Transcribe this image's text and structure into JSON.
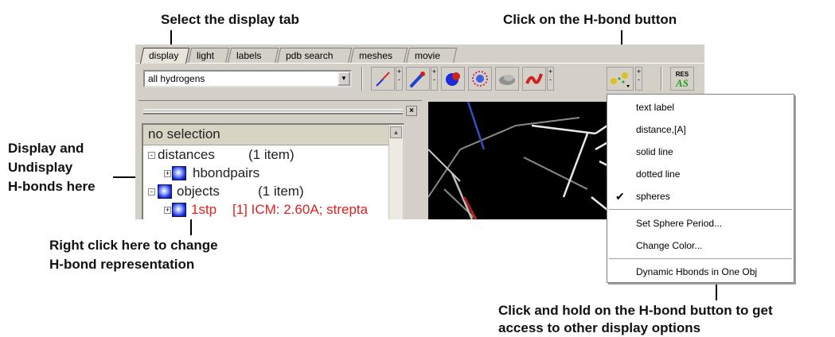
{
  "annotations": {
    "select_tab": "Select the display tab",
    "click_hbond": "Click on the H-bond button",
    "display_undisplay_1": "Display and",
    "display_undisplay_2": "Undisplay",
    "display_undisplay_3": "H-bonds here",
    "right_click_1": "Right click here to change",
    "right_click_2": "H-bond representation",
    "click_hold_1": "Click and hold on the H-bond button to get",
    "click_hold_2": "access to other display options"
  },
  "tabs": [
    "display",
    "light",
    "labels",
    "pdb search",
    "meshes",
    "movie"
  ],
  "toolbar": {
    "combo_value": "all hydrogens",
    "res_label": "RES",
    "as_label": "AS",
    "icons": [
      "wire-icon",
      "stick-icon",
      "ball-icon",
      "surface-icon",
      "skin-icon",
      "ribbon-icon",
      "hbond-icon"
    ]
  },
  "tree": {
    "selection": "no selection",
    "rows": [
      {
        "label": "distances",
        "count": "(1 item)"
      },
      {
        "label": "hbondpairs"
      },
      {
        "label": "objects",
        "count": "(1 item)"
      },
      {
        "label": "1stp",
        "detail": "[1] ICM: 2.60A; strepta"
      }
    ]
  },
  "menu": {
    "items": [
      "text label",
      "distance,[A]",
      "solid line",
      "dotted line",
      "spheres",
      "Set Sphere Period...",
      "Change Color...",
      "Dynamic Hbonds in One Obj"
    ],
    "checked": "spheres"
  }
}
